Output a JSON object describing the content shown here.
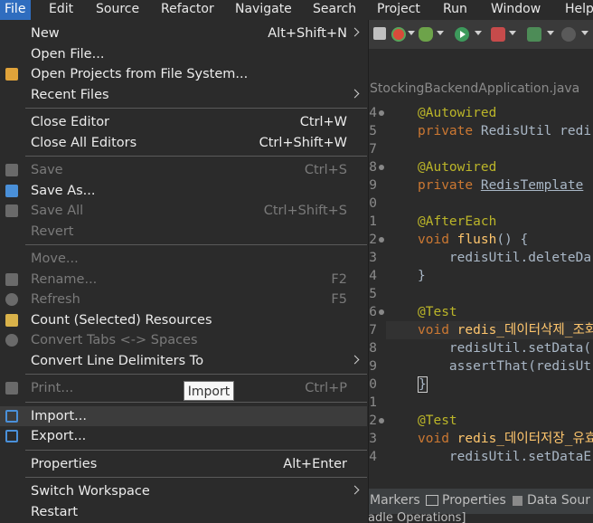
{
  "menubar": {
    "items": [
      "File",
      "Edit",
      "Source",
      "Refactor",
      "Navigate",
      "Search",
      "Project",
      "Run",
      "Window",
      "Help"
    ]
  },
  "editor": {
    "tab_title": "StockingBackendApplication.java",
    "lines": [
      {
        "no": "4",
        "code": [
          {
            "t": "@Autowired",
            "c": "ann"
          }
        ]
      },
      {
        "no": "5",
        "code": [
          {
            "t": "private ",
            "c": "kw"
          },
          {
            "t": "RedisUtil redi",
            "c": "cls"
          }
        ]
      },
      {
        "no": "7",
        "code": []
      },
      {
        "no": "8",
        "code": [
          {
            "t": "@Autowired",
            "c": "ann"
          }
        ]
      },
      {
        "no": "9",
        "code": [
          {
            "t": "private ",
            "c": "kw"
          },
          {
            "t": "RedisTemplate",
            "c": "cls"
          }
        ]
      },
      {
        "no": "0",
        "code": []
      },
      {
        "no": "1",
        "code": [
          {
            "t": "@AfterEach",
            "c": "ann"
          }
        ]
      },
      {
        "no": "2",
        "code": [
          {
            "t": "void ",
            "c": "kw"
          },
          {
            "t": "flush",
            "c": "fn"
          },
          {
            "t": "() {",
            "c": "plain"
          }
        ]
      },
      {
        "no": "3",
        "code": [
          {
            "t": "    redisUtil.deleteDa",
            "c": "plain"
          }
        ]
      },
      {
        "no": "4",
        "code": [
          {
            "t": "}",
            "c": "plain"
          }
        ]
      },
      {
        "no": "5",
        "code": []
      },
      {
        "no": "6",
        "code": [
          {
            "t": "@Test",
            "c": "ann"
          }
        ]
      },
      {
        "no": "7",
        "code": [
          {
            "t": "void ",
            "c": "kw"
          },
          {
            "t": "redis_데이터삭제_조회",
            "c": "fn"
          }
        ]
      },
      {
        "no": "8",
        "code": [
          {
            "t": "    redisUtil.setData(",
            "c": "plain"
          }
        ]
      },
      {
        "no": "9",
        "code": [
          {
            "t": "    assertThat(redisUt",
            "c": "plain"
          }
        ]
      },
      {
        "no": "0",
        "code": [
          {
            "t": "}",
            "c": "plain"
          }
        ]
      },
      {
        "no": "1",
        "code": []
      },
      {
        "no": "2",
        "code": [
          {
            "t": "@Test",
            "c": "ann"
          }
        ]
      },
      {
        "no": "3",
        "code": [
          {
            "t": "void ",
            "c": "kw"
          },
          {
            "t": "redis_데이터저장_유효",
            "c": "fn"
          }
        ]
      },
      {
        "no": "4",
        "code": [
          {
            "t": "    redisUtil.setDataE",
            "c": "plain"
          }
        ]
      }
    ]
  },
  "bottom_tabs": {
    "markers": "Markers",
    "properties": "Properties",
    "data_source": "Data Sour",
    "sub": "adle Operations]"
  },
  "tooltip": "Import",
  "file_menu": {
    "items": [
      {
        "label": "New",
        "shortcut": "Alt+Shift+N",
        "submenu": true,
        "disabled": false,
        "icon": ""
      },
      {
        "label": "Open File...",
        "shortcut": "",
        "submenu": false,
        "disabled": false,
        "icon": ""
      },
      {
        "label": "Open Projects from File System...",
        "shortcut": "",
        "submenu": false,
        "disabled": false,
        "icon": "folder-icon"
      },
      {
        "label": "Recent Files",
        "shortcut": "",
        "submenu": true,
        "disabled": false,
        "icon": ""
      },
      {
        "sep": true
      },
      {
        "label": "Close Editor",
        "shortcut": "Ctrl+W",
        "submenu": false,
        "disabled": false,
        "icon": ""
      },
      {
        "label": "Close All Editors",
        "shortcut": "Ctrl+Shift+W",
        "submenu": false,
        "disabled": false,
        "icon": ""
      },
      {
        "sep": true
      },
      {
        "label": "Save",
        "shortcut": "Ctrl+S",
        "submenu": false,
        "disabled": true,
        "icon": "save-icon"
      },
      {
        "label": "Save As...",
        "shortcut": "",
        "submenu": false,
        "disabled": false,
        "icon": "save-as-icon"
      },
      {
        "label": "Save All",
        "shortcut": "Ctrl+Shift+S",
        "submenu": false,
        "disabled": true,
        "icon": "save-all-icon"
      },
      {
        "label": "Revert",
        "shortcut": "",
        "submenu": false,
        "disabled": true,
        "icon": ""
      },
      {
        "sep": true
      },
      {
        "label": "Move...",
        "shortcut": "",
        "submenu": false,
        "disabled": true,
        "icon": ""
      },
      {
        "label": "Rename...",
        "shortcut": "F2",
        "submenu": false,
        "disabled": true,
        "icon": "rename-icon"
      },
      {
        "label": "Refresh",
        "shortcut": "F5",
        "submenu": false,
        "disabled": true,
        "icon": "refresh-icon"
      },
      {
        "label": "Count (Selected) Resources",
        "shortcut": "",
        "submenu": false,
        "disabled": false,
        "icon": "count-resources-icon"
      },
      {
        "label": "Convert Tabs <-> Spaces",
        "shortcut": "",
        "submenu": false,
        "disabled": true,
        "icon": "convert-tabs-icon"
      },
      {
        "label": "Convert Line Delimiters To",
        "shortcut": "",
        "submenu": true,
        "disabled": false,
        "icon": ""
      },
      {
        "sep": true
      },
      {
        "label": "Print...",
        "shortcut": "Ctrl+P",
        "submenu": false,
        "disabled": true,
        "icon": "print-icon"
      },
      {
        "sep": true
      },
      {
        "label": "Import...",
        "shortcut": "",
        "submenu": false,
        "disabled": false,
        "icon": "import-icon",
        "selected": true
      },
      {
        "label": "Export...",
        "shortcut": "",
        "submenu": false,
        "disabled": false,
        "icon": "export-icon"
      },
      {
        "sep": true
      },
      {
        "label": "Properties",
        "shortcut": "Alt+Enter",
        "submenu": false,
        "disabled": false,
        "icon": ""
      },
      {
        "sep": true
      },
      {
        "label": "Switch Workspace",
        "shortcut": "",
        "submenu": true,
        "disabled": false,
        "icon": ""
      },
      {
        "label": "Restart",
        "shortcut": "",
        "submenu": false,
        "disabled": false,
        "icon": ""
      }
    ]
  },
  "colors": {
    "accent": "#2f6dbf",
    "menu_bg": "#2b2b2b",
    "annotation": "#bbb529",
    "keyword": "#cc7832",
    "method": "#ffc66d"
  }
}
